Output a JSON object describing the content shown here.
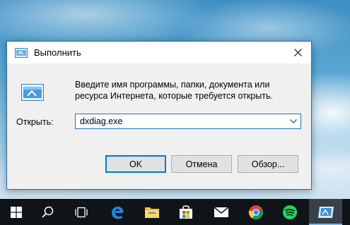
{
  "dialog": {
    "title": "Выполнить",
    "description": "Введите имя программы, папки, документа или ресурса Интернета, которые требуется открыть.",
    "open_label": "Открыть:",
    "open_value": "dxdiag.exe",
    "buttons": {
      "ok": "OK",
      "cancel": "Отмена",
      "browse": "Обзор..."
    }
  },
  "taskbar": {
    "items": [
      {
        "icon": "windows-start-icon"
      },
      {
        "icon": "search-icon"
      },
      {
        "icon": "task-view-icon"
      },
      {
        "icon": "edge-icon"
      },
      {
        "icon": "file-explorer-icon"
      },
      {
        "icon": "store-icon"
      },
      {
        "icon": "mail-icon"
      },
      {
        "icon": "chrome-icon"
      },
      {
        "icon": "spotify-icon"
      },
      {
        "icon": "run-icon",
        "active": true
      }
    ]
  },
  "colors": {
    "accent": "#0078d7",
    "taskbar": "#101419",
    "dialog_bg": "#f0f0f0"
  }
}
